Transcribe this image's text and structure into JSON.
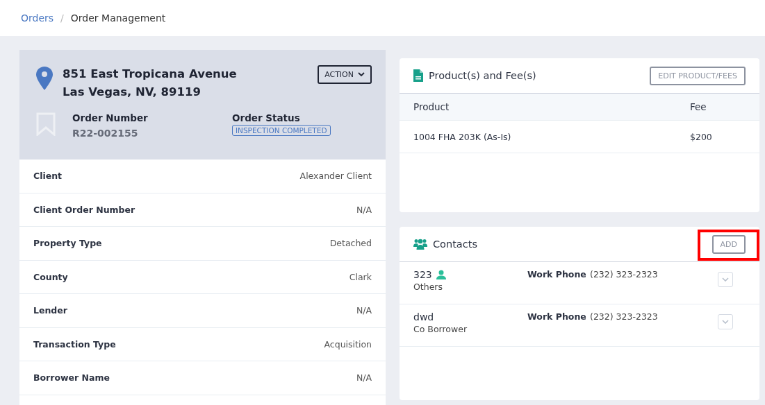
{
  "breadcrumb": {
    "separator": "/",
    "items": [
      {
        "label": "Orders",
        "link": true
      },
      {
        "label": "Order Management",
        "link": false
      }
    ]
  },
  "order": {
    "address_line1": "851 East Tropicana Avenue",
    "address_line2": "Las Vegas, NV, 89119",
    "action_button": "ACTION",
    "bookmarked": false,
    "order_number_label": "Order Number",
    "order_number": "R22-002155",
    "status_label": "Order Status",
    "status": "INSPECTION COMPLETED"
  },
  "details": [
    {
      "label": "Client",
      "value": "Alexander Client"
    },
    {
      "label": "Client Order Number",
      "value": "N/A"
    },
    {
      "label": "Property Type",
      "value": "Detached"
    },
    {
      "label": "County",
      "value": "Clark"
    },
    {
      "label": "Lender",
      "value": "N/A"
    },
    {
      "label": "Transaction Type",
      "value": "Acquisition"
    },
    {
      "label": "Borrower Name",
      "value": "N/A"
    }
  ],
  "products": {
    "title": "Product(s) and Fee(s)",
    "edit_button": "EDIT PRODUCT/FEES",
    "columns": [
      "Product",
      "Fee"
    ],
    "rows": [
      {
        "product": "1004 FHA 203K (As-Is)",
        "fee": "$200"
      }
    ]
  },
  "contacts": {
    "title": "Contacts",
    "add_button": {
      "label": "ADD",
      "highlighted": true
    },
    "rows": [
      {
        "name": "323",
        "primary": true,
        "role": "Others",
        "phone_label": "Work Phone",
        "phone": "(232) 323-2323"
      },
      {
        "name": "dwd",
        "primary": false,
        "role": "Co Borrower",
        "phone_label": "Work Phone",
        "phone": "(232) 323-2323"
      }
    ]
  }
}
